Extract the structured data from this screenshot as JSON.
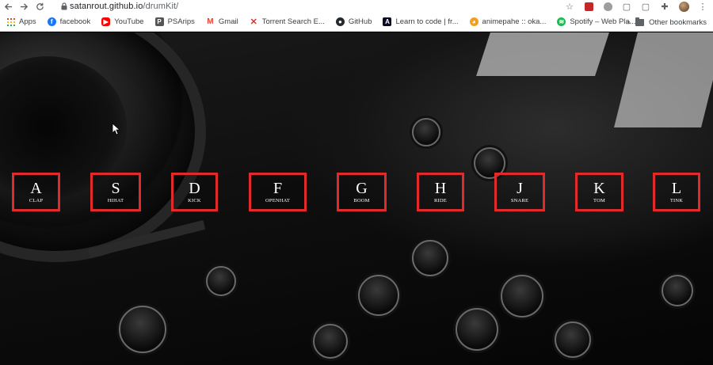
{
  "browser": {
    "url_host": "satanrout.github.io",
    "url_path": "/drumKit/"
  },
  "bookmarks": [
    {
      "label": "Apps",
      "icon": "apps-grid-icon",
      "color": "#ea4335"
    },
    {
      "label": "facebook",
      "icon": "facebook-icon",
      "color": "#1877f2"
    },
    {
      "label": "YouTube",
      "icon": "youtube-icon",
      "color": "#ff0000"
    },
    {
      "label": "PSArips",
      "icon": "psarips-icon",
      "color": "#555555"
    },
    {
      "label": "Gmail",
      "icon": "gmail-icon",
      "color": "#ea4335"
    },
    {
      "label": "Torrent Search E...",
      "icon": "torrent-icon",
      "color": "#d93025"
    },
    {
      "label": "GitHub",
      "icon": "github-icon",
      "color": "#24292e"
    },
    {
      "label": "Learn to code | fr...",
      "icon": "freecodecamp-icon",
      "color": "#0a0a23"
    },
    {
      "label": "animepahe :: oka...",
      "icon": "animepahe-icon",
      "color": "#f0a020"
    },
    {
      "label": "Spotify – Web Pla...",
      "icon": "spotify-icon",
      "color": "#1db954"
    }
  ],
  "bookmarks_other": "Other bookmarks",
  "bookmarks_more": "»",
  "drum_kit": {
    "accent_color": "#e32a2a",
    "keys": [
      {
        "key": "A",
        "sound": "CLAP"
      },
      {
        "key": "S",
        "sound": "HIHAT"
      },
      {
        "key": "D",
        "sound": "KICK"
      },
      {
        "key": "F",
        "sound": "OPENHAT"
      },
      {
        "key": "G",
        "sound": "BOOM"
      },
      {
        "key": "H",
        "sound": "RIDE"
      },
      {
        "key": "J",
        "sound": "SNARE"
      },
      {
        "key": "K",
        "sound": "TOM"
      },
      {
        "key": "L",
        "sound": "TINK"
      }
    ]
  }
}
